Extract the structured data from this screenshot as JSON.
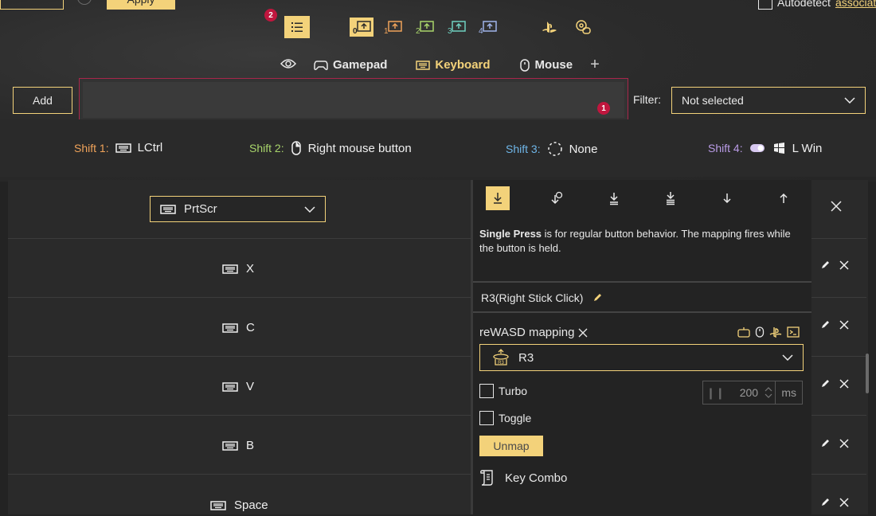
{
  "top": {
    "apply_label": "Apply",
    "autodetect_text": "Autodetect",
    "autodetect_link": "associate"
  },
  "badges": {
    "one": "1",
    "two": "2"
  },
  "slots": [
    "0",
    "1",
    "2",
    "3",
    "4"
  ],
  "tabs": {
    "gamepad": "Gamepad",
    "keyboard": "Keyboard",
    "mouse": "Mouse",
    "add": "+"
  },
  "toolbar": {
    "add_label": "Add",
    "filter_label": "Filter:",
    "filter_value": "Not selected"
  },
  "shifts": [
    {
      "label": "Shift 1:",
      "value": "LCtrl",
      "color": "#f0a35a"
    },
    {
      "label": "Shift 2:",
      "value": "Right mouse button",
      "color": "#a9d56b"
    },
    {
      "label": "Shift 3:",
      "value": "None",
      "color": "#6fb6e8"
    },
    {
      "label": "Shift 4:",
      "value": "L Win",
      "color": "#b99be6"
    }
  ],
  "rows": [
    {
      "key": "PrtScr"
    },
    {
      "key": "X"
    },
    {
      "key": "C"
    },
    {
      "key": "V"
    },
    {
      "key": "B"
    },
    {
      "key": "Space"
    }
  ],
  "panel": {
    "desc_bold": "Single Press",
    "desc_rest": " is for regular button behavior. The mapping fires while the button is held.",
    "button_name": "R3(Right Stick Click)",
    "mapping_title": "reWASD mapping",
    "mapping_value": "R3",
    "turbo_label": "Turbo",
    "toggle_label": "Toggle",
    "turbo_ms_value": "200",
    "ms_unit": "ms",
    "unmap_label": "Unmap",
    "combo_label": "Key Combo"
  },
  "colors": {
    "accent": "#f3d27a",
    "background": "#232323",
    "badge": "#c0163e",
    "highlight_border": "#a8264b"
  }
}
